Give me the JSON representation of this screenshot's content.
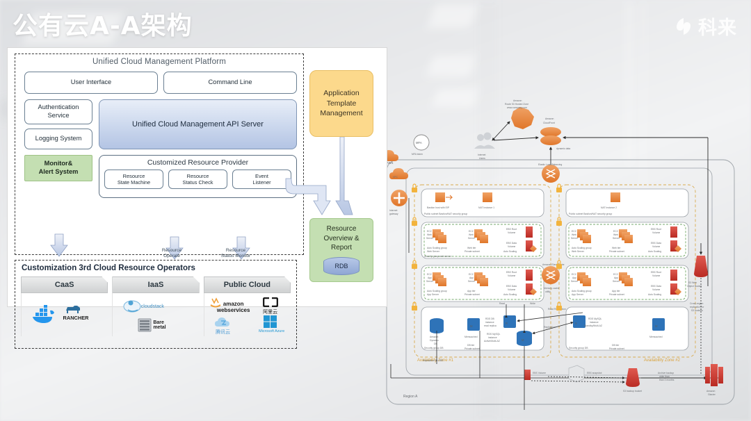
{
  "header": {
    "title": "公有云A-A架构",
    "logo_text": "科来",
    "logo_icon": "pinwheel-icon"
  },
  "left_diagram": {
    "platform": {
      "title": "Unified Cloud Management Platform",
      "user_interface": "User Interface",
      "command_line": "Command Line",
      "authentication_service": "Authentication\nService",
      "logging_system": "Logging System",
      "monitor_alert": "Monitor&\nAlert System",
      "api_server": "Unified Cloud Management API Server",
      "crp_title": "Customized Resource Provider",
      "crp_cells": [
        "Resource\nState Machine",
        "Resource\nStatus Check",
        "Event\nListener"
      ]
    },
    "arrows": {
      "resource_operate": "Resource\nOperate",
      "resource_status_monitor": "Resource\nStatus Monitor"
    },
    "customization": {
      "title": "Customization 3rd  Cloud Resource Operators",
      "title_sup": "rd",
      "tabs": [
        {
          "label": "CaaS",
          "logos": [
            {
              "name": "docker-logo",
              "text": "docker"
            },
            {
              "name": "rancher-logo",
              "text": "RANCHER"
            }
          ]
        },
        {
          "label": "IaaS",
          "logos": [
            {
              "name": "cloudstack-logo",
              "text": "cloudstack"
            },
            {
              "name": "bare-metal-logo",
              "text": "Bare\nmetal"
            }
          ]
        },
        {
          "label": "Public Cloud",
          "logos": [
            {
              "name": "aws-logo",
              "text": "amazon\nwebservices"
            },
            {
              "name": "aliyun-logo",
              "text": "阿里云"
            },
            {
              "name": "tencent-cloud-logo",
              "text": "腾讯云"
            },
            {
              "name": "azure-logo",
              "text": "Microsoft Azure"
            }
          ]
        }
      ]
    },
    "app_template": "Application\nTemplate\nManagement",
    "resource_overview": "Resource\nOverview &\nReport",
    "rdb": "RDB"
  },
  "aws_diagram": {
    "labels": {
      "aws_cloud": "AWS",
      "mfa": "MFA",
      "mfa_token": "MFA token",
      "vpc1": "VPC",
      "vpc2": "VPC",
      "internet_gateway": "Internet\ngateway",
      "users": "Internet\nUsers",
      "route53": "Amazon\nRoute 53 Hosted Zone\nwww.company.com",
      "cloudfront": "Amazon\nCloudFront",
      "static_content": "Static content\nStatic site",
      "dynamic_data": "dynamic data",
      "elb": "Elastic Load Balancing",
      "bastion": "Bastion host with EIP",
      "nat1": "NAT Instance 1",
      "nat2": "NAT Instance 2",
      "public_subnet_sg": "Public subnet  Bastion/NAT security group",
      "ec2_web_server": "EC2\nWeb\nServer",
      "ebs_root_volume": "EBS Root\nVolume",
      "ebs_data_volume": "EBS Data\nVolume",
      "autoscaling_group_web": "Auto Scaling group\nWeb Server",
      "web_tier_private_subnet": "Web tier\nPrivate subnet",
      "auto_scaling": "Auto Scaling",
      "security_group_db": "Security group    DB",
      "ec2_app_server": "EC2\nApp\nServer",
      "autoscaling_group_app": "Auto Scaling group\nApp Server",
      "app_tier_private_subnet": "App tier\nPrivate subnet",
      "elasticache": "Amazon ElastiCache\nMemory cache",
      "dynamodb": "Amazon\nDynamo\nDB",
      "memcached": "Memcached",
      "rds_read_replica": "RDS DB\ninstance\nread replica",
      "rds_mysql_active": "RDS MySQL\ninstance\nActive/Multi-AZ",
      "rds_mysql_standby": "RDS MySQL\ninstance\nStandby/Multi-AZ",
      "db_tier_private_subnet": "DB tier\nPrivate subnet",
      "replication": "Replication",
      "read_replication": "Read Replication",
      "write": "Write",
      "read": "Read",
      "az1": "Availability Zone #1",
      "az2": "Availability Zone #2",
      "region_a": "Region A",
      "replication_ebs": "Replication for EBS",
      "ebs_volume": "EBS Volume",
      "ebs_snapshot": "EBS snapshot",
      "s3_backup_bucket": "S3 backup  bucket",
      "s3_web_object_bucket": "S3 Web\nObject Bucket",
      "amazon_glacier": "Amazon\nGlacier",
      "archive_older": "Archive  backup\nolder  than\nthan 3  months",
      "versioning_note": "Cross-region\nreplication for\nS3 buckets"
    },
    "colors": {
      "aws_orange": "#e8762d",
      "aws_red": "#c7322a",
      "aws_blue": "#2e73b8",
      "vpc_dashed": "#c8a24b",
      "subnet_dashed": "#4a8f3c"
    }
  }
}
